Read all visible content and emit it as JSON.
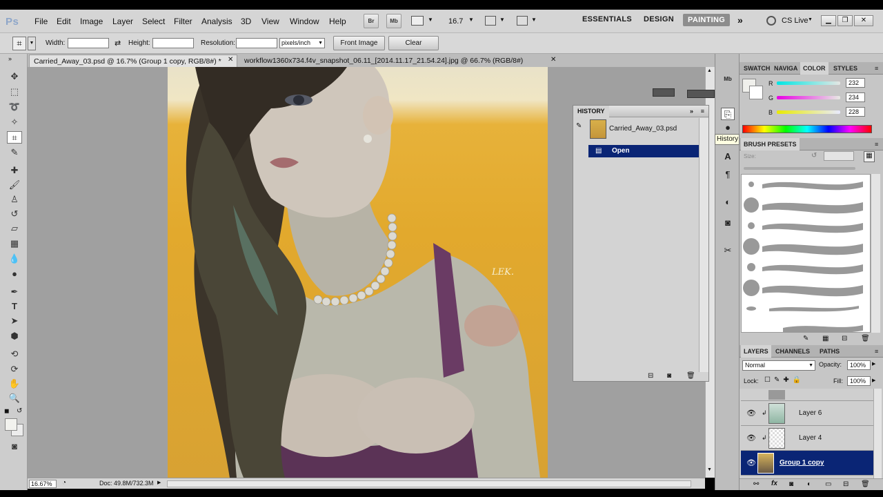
{
  "menubar": {
    "app_logo": "Ps",
    "items": [
      "File",
      "Edit",
      "Image",
      "Layer",
      "Select",
      "Filter",
      "Analysis",
      "3D",
      "View",
      "Window",
      "Help"
    ],
    "bridge_label": "Br",
    "minibridge_label": "Mb",
    "zoom": "16.7",
    "workspaces": [
      "ESSENTIALS",
      "DESIGN",
      "PAINTING"
    ],
    "active_workspace": "PAINTING",
    "cslive": "CS Live"
  },
  "options": {
    "width_label": "Width:",
    "height_label": "Height:",
    "resolution_label": "Resolution:",
    "units": "pixels/inch",
    "front_image": "Front Image",
    "clear": "Clear"
  },
  "tabs": [
    {
      "label": "Carried_Away_03.psd @ 16.7% (Group 1 copy, RGB/8#) *"
    },
    {
      "label": "workflow1360x734.f4v_snapshot_06.11_[2014.11.17_21.54.24].jpg @ 66.7% (RGB/8#)"
    }
  ],
  "canvas": {
    "signature": "LEK."
  },
  "status": {
    "zoom": "16.67%",
    "doc": "Doc: 49.8M/732.3M"
  },
  "history": {
    "title": "HISTORY",
    "snapshot": "Carried_Away_03.psd",
    "states": [
      "Open"
    ],
    "tooltip": "History"
  },
  "color_panel": {
    "tabs": [
      "SWATCH",
      "NAVIGA",
      "COLOR",
      "STYLES"
    ],
    "active": "COLOR",
    "channels": [
      {
        "label": "R",
        "value": "232"
      },
      {
        "label": "G",
        "value": "234"
      },
      {
        "label": "B",
        "value": "228"
      }
    ]
  },
  "brush_presets": {
    "title": "BRUSH PRESETS",
    "size_label": "Size:"
  },
  "layers_panel": {
    "tabs": [
      "LAYERS",
      "CHANNELS",
      "PATHS"
    ],
    "blend_mode": "Normal",
    "opacity_label": "Opacity:",
    "opacity": "100%",
    "lock_label": "Lock:",
    "fill_label": "Fill:",
    "fill": "100%",
    "layers": [
      "Layer 6",
      "Layer 4",
      "Group 1 copy"
    ]
  }
}
